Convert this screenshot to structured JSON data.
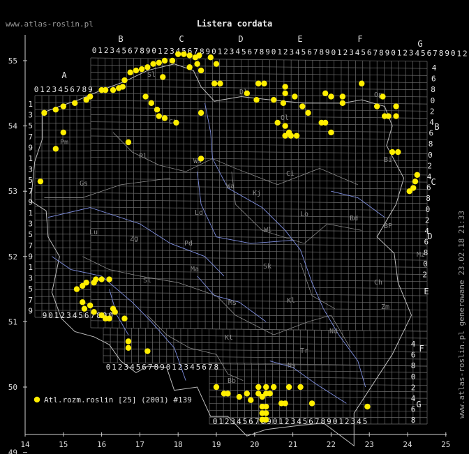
{
  "title": "Listera cordata",
  "credit_left": "www.atlas-roslin.pl",
  "credit_right": "www.atlas-roslin.pl generowane 23.02.18 21:33",
  "legend_label": "Atl.rozm.roslin [25] (2001) #139",
  "colors": {
    "dot": "#ffee00",
    "grid": "#6e6e6e",
    "border": "#bdbdbd",
    "river": "#7f8fe0",
    "region": "#8c8c8c"
  },
  "axis": {
    "lon_labels": [
      "14",
      "15",
      "16",
      "17",
      "18",
      "19",
      "20",
      "21",
      "22",
      "23",
      "24",
      "25"
    ],
    "lat_labels": [
      "55",
      "54",
      "53",
      "52",
      "51",
      "50",
      "49"
    ]
  },
  "grid_letters": {
    "top": [
      "A",
      "B",
      "C",
      "D",
      "E",
      "F",
      "G"
    ],
    "right": [
      "B",
      "C",
      "D",
      "E",
      "F",
      "G"
    ]
  },
  "grid_digits": {
    "top_a": "0123456789",
    "top_main": "0123456789012345678901234567890123456789012345678901234567890123456789",
    "left": [
      "1",
      "3",
      "5",
      "7",
      "9",
      "1",
      "3",
      "5",
      "7",
      "9",
      "1",
      "3",
      "5",
      "7",
      "9",
      "1",
      "3",
      "5",
      "7",
      "9"
    ],
    "bottom_left": "901234567890",
    "bottom_mid": "0123456789012345678",
    "bottom_right": "01234567890123456789012345",
    "right": [
      "4",
      "6",
      "8",
      "0",
      "2",
      "4",
      "6",
      "8",
      "0",
      "2",
      "4",
      "6",
      "8",
      "0",
      "2",
      "4",
      "6",
      "8",
      "0",
      "2"
    ],
    "right_low": [
      "4",
      "6",
      "8",
      "0",
      "2",
      "4",
      "6",
      "8"
    ]
  },
  "regions": [
    "Pm",
    "Sl",
    "Ch",
    "Dl",
    "Ol",
    "Bi",
    "Ci",
    "Pl",
    "Gs",
    "Wa",
    "Kj",
    "Ld",
    "Lo",
    "Le",
    "Zg",
    "Lu",
    "Wl",
    "Pd",
    "Rd",
    "Sk",
    "Ms",
    "Ma",
    "Sl",
    "Kt",
    "Kl",
    "Nd",
    "BP",
    "Op",
    "Mz",
    "Zm",
    "Tr",
    "Ws",
    "Ch",
    "Ns",
    "Bb"
  ],
  "occurrences": [
    [
      14.5,
      54.2
    ],
    [
      14.8,
      54.25
    ],
    [
      15.0,
      54.3
    ],
    [
      15.3,
      54.35
    ],
    [
      15.6,
      54.4
    ],
    [
      15.7,
      54.45
    ],
    [
      16.0,
      54.55
    ],
    [
      16.1,
      54.55
    ],
    [
      16.3,
      54.55
    ],
    [
      16.45,
      54.58
    ],
    [
      16.55,
      54.6
    ],
    [
      16.6,
      54.7
    ],
    [
      16.75,
      54.82
    ],
    [
      16.9,
      54.85
    ],
    [
      17.05,
      54.87
    ],
    [
      17.2,
      54.9
    ],
    [
      17.35,
      54.95
    ],
    [
      17.5,
      54.97
    ],
    [
      17.65,
      55.0
    ],
    [
      17.85,
      55.0
    ],
    [
      18.0,
      55.1
    ],
    [
      18.15,
      55.1
    ],
    [
      18.3,
      55.08
    ],
    [
      18.45,
      55.05
    ],
    [
      18.55,
      55.08
    ],
    [
      18.3,
      54.9
    ],
    [
      18.5,
      54.95
    ],
    [
      18.6,
      54.85
    ],
    [
      18.85,
      55.05
    ],
    [
      19.0,
      54.95
    ],
    [
      17.6,
      54.75
    ],
    [
      18.95,
      54.65
    ],
    [
      19.1,
      54.65
    ],
    [
      17.15,
      54.45
    ],
    [
      17.3,
      54.35
    ],
    [
      17.45,
      54.25
    ],
    [
      17.5,
      54.15
    ],
    [
      17.65,
      54.12
    ],
    [
      17.95,
      54.05
    ],
    [
      18.6,
      54.2
    ],
    [
      16.7,
      53.75
    ],
    [
      15.0,
      53.9
    ],
    [
      14.8,
      53.65
    ],
    [
      14.4,
      53.15
    ],
    [
      18.6,
      53.5
    ],
    [
      20.1,
      54.65
    ],
    [
      20.25,
      54.65
    ],
    [
      19.8,
      54.5
    ],
    [
      20.05,
      54.4
    ],
    [
      20.5,
      54.4
    ],
    [
      20.8,
      54.6
    ],
    [
      20.8,
      54.5
    ],
    [
      20.75,
      54.35
    ],
    [
      21.05,
      54.45
    ],
    [
      21.25,
      54.3
    ],
    [
      21.4,
      54.2
    ],
    [
      21.75,
      54.05
    ],
    [
      21.85,
      54.05
    ],
    [
      21.85,
      54.5
    ],
    [
      22.0,
      54.45
    ],
    [
      22.3,
      54.45
    ],
    [
      22.3,
      54.35
    ],
    [
      22.8,
      54.65
    ],
    [
      23.2,
      54.3
    ],
    [
      23.35,
      54.45
    ],
    [
      23.4,
      54.15
    ],
    [
      23.5,
      54.15
    ],
    [
      23.7,
      54.15
    ],
    [
      23.7,
      54.3
    ],
    [
      20.6,
      54.05
    ],
    [
      20.9,
      53.9
    ],
    [
      20.8,
      53.85
    ],
    [
      20.95,
      53.85
    ],
    [
      21.1,
      53.85
    ],
    [
      20.8,
      54.0
    ],
    [
      22.0,
      53.9
    ],
    [
      23.6,
      53.6
    ],
    [
      23.75,
      53.6
    ],
    [
      24.05,
      53.0
    ],
    [
      24.15,
      53.05
    ],
    [
      24.2,
      53.15
    ],
    [
      24.25,
      53.25
    ],
    [
      15.35,
      51.5
    ],
    [
      15.5,
      51.55
    ],
    [
      15.6,
      51.6
    ],
    [
      15.8,
      51.6
    ],
    [
      15.85,
      51.65
    ],
    [
      16.0,
      51.65
    ],
    [
      16.2,
      51.65
    ],
    [
      15.5,
      51.3
    ],
    [
      15.55,
      51.2
    ],
    [
      15.7,
      51.25
    ],
    [
      15.8,
      51.15
    ],
    [
      16.0,
      51.1
    ],
    [
      16.1,
      51.05
    ],
    [
      16.2,
      51.05
    ],
    [
      16.3,
      51.2
    ],
    [
      16.35,
      51.15
    ],
    [
      16.6,
      51.05
    ],
    [
      16.7,
      50.7
    ],
    [
      16.7,
      50.6
    ],
    [
      17.2,
      50.55
    ],
    [
      19.0,
      50.0
    ],
    [
      19.2,
      49.9
    ],
    [
      19.3,
      49.9
    ],
    [
      19.6,
      49.85
    ],
    [
      19.8,
      49.9
    ],
    [
      19.9,
      49.8
    ],
    [
      20.1,
      49.9
    ],
    [
      20.2,
      49.85
    ],
    [
      20.3,
      49.9
    ],
    [
      20.4,
      49.9
    ],
    [
      20.1,
      50.0
    ],
    [
      20.3,
      50.0
    ],
    [
      20.5,
      50.0
    ],
    [
      20.2,
      49.7
    ],
    [
      20.3,
      49.7
    ],
    [
      20.2,
      49.6
    ],
    [
      20.3,
      49.6
    ],
    [
      20.2,
      49.5
    ],
    [
      20.3,
      49.5
    ],
    [
      20.7,
      49.75
    ],
    [
      20.8,
      49.75
    ],
    [
      20.9,
      50.0
    ],
    [
      21.2,
      50.0
    ],
    [
      21.5,
      49.75
    ],
    [
      22.95,
      49.7
    ]
  ]
}
